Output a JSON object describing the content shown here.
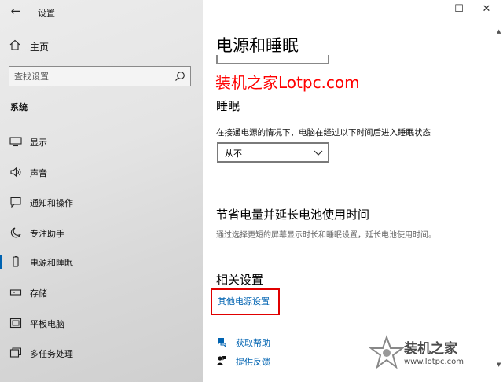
{
  "window": {
    "title": "设置",
    "back_glyph": "←",
    "controls": {
      "minimize": "—",
      "maximize": "☐",
      "close": "✕"
    }
  },
  "sidebar": {
    "home_label": "主页",
    "search_placeholder": "查找设置",
    "section_label": "系统",
    "items": [
      {
        "label": "显示",
        "icon": "monitor-icon",
        "active": false
      },
      {
        "label": "声音",
        "icon": "speaker-icon",
        "active": false
      },
      {
        "label": "通知和操作",
        "icon": "notification-icon",
        "active": false
      },
      {
        "label": "专注助手",
        "icon": "moon-icon",
        "active": false
      },
      {
        "label": "电源和睡眠",
        "icon": "power-icon",
        "active": true
      },
      {
        "label": "存储",
        "icon": "storage-icon",
        "active": false
      },
      {
        "label": "平板电脑",
        "icon": "tablet-icon",
        "active": false
      },
      {
        "label": "多任务处理",
        "icon": "multitask-icon",
        "active": false
      }
    ]
  },
  "main": {
    "title": "电源和睡眠",
    "watermark_text": "装机之家Lotpc.com",
    "sleep": {
      "heading": "睡眠",
      "description": "在接通电源的情况下，电脑在经过以下时间后进入睡眠状态",
      "dropdown_value": "从不"
    },
    "battery": {
      "heading": "节省电量并延长电池使用时间",
      "description": "通过选择更短的屏幕显示时长和睡眠设置，延长电池使用时间。"
    },
    "related": {
      "heading": "相关设置",
      "link": "其他电源设置"
    },
    "help": {
      "get_help": "获取帮助",
      "feedback": "提供反馈"
    }
  },
  "logo_watermark": {
    "brand": "装机之家",
    "url": "www.lotpc.com"
  },
  "colors": {
    "accent": "#0063b1",
    "highlight_red": "#e00000",
    "sidebar_bg": "#e6e6e6"
  }
}
